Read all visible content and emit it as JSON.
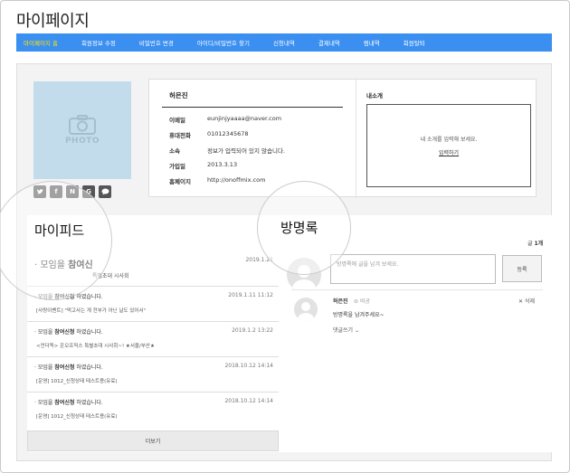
{
  "page": {
    "title": "마이페이지"
  },
  "nav": [
    "마이페이지 홈",
    "회원정보 수정",
    "비밀번호 변경",
    "아이디/비밀번호 찾기",
    "신청내역",
    "결제내역",
    "찜내역",
    "회원탈퇴"
  ],
  "photo": {
    "label": "PHOTO"
  },
  "socials": [
    "twitter",
    "facebook",
    "naver",
    "google",
    "message"
  ],
  "profile": {
    "name": "허은진",
    "rows": [
      {
        "label": "이메일",
        "value": "eunjinjyaaaa@naver.com"
      },
      {
        "label": "휴대전화",
        "value": "01012345678"
      },
      {
        "label": "소속",
        "value": "정보가 입력되어 있지 않습니다."
      },
      {
        "label": "가입일",
        "value": "2013.3.13"
      },
      {
        "label": "홈페이지",
        "value": "http://onoffmix.com"
      }
    ]
  },
  "intro": {
    "title": "내소개",
    "placeholder": "내 소개를 입력해 보세요.",
    "link": "입력하기"
  },
  "feed": {
    "title": "마이피드",
    "first": {
      "prefix": "· 모임을 ",
      "bold": "참여신",
      "sub": "특별초대 시사회",
      "time": "2019.1.21"
    },
    "items": [
      {
        "prefix": "· 모임을 ",
        "bold": "참여신청",
        "suffix": " 하였습니다.",
        "sub": "[사랑이벤트] \"먹고사는 게 전부가 아닌 날도 있어서\"",
        "time": "2019.1.11 11:12"
      },
      {
        "prefix": "· 모임을 ",
        "bold": "참여신청",
        "suffix": " 하였습니다.",
        "sub": "<언더독> 온오프믹스 특별초대 시사회~! ★서울/부산★",
        "time": "2019.1.2 13:22"
      },
      {
        "prefix": "· 모임을 ",
        "bold": "참여신청",
        "suffix": " 하였습니다.",
        "sub": "[운영] 1012_신청상태 테스트용(유료)",
        "time": "2018.10.12 14:14"
      },
      {
        "prefix": "· 모임을 ",
        "bold": "참여신청",
        "suffix": " 하였습니다.",
        "sub": "[운영] 1012_신청상태 테스트용(유료)",
        "time": "2018.10.12 14:14"
      }
    ],
    "more": "더보기"
  },
  "guestbook": {
    "title": "방명록",
    "count_label": "글 ",
    "count_value": "1개",
    "placeholder": "방명록에 글을 남겨 보세요.",
    "submit": "등록",
    "comment": {
      "name": "허은진",
      "lock": "비공",
      "delete": "삭제",
      "text": "방명록을 남겨주세요~",
      "reply": "댓글쓰기"
    }
  }
}
